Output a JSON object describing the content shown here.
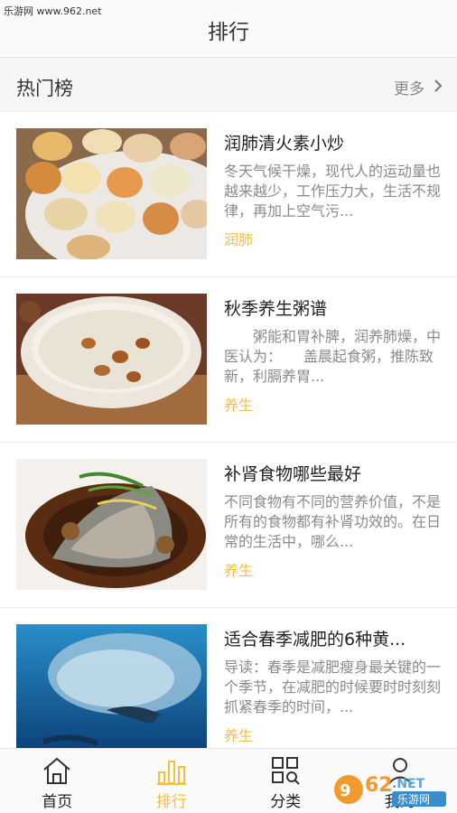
{
  "watermark": "乐游网 www.962.net",
  "header": {
    "title": "排行"
  },
  "section": {
    "title": "热门榜",
    "more_label": "更多"
  },
  "items": [
    {
      "title": "润肺清火素小炒",
      "desc": "冬天气候干燥，现代人的运动量也越来越少，工作压力大，生活不规律，再加上空气污...",
      "tag": "润肺"
    },
    {
      "title": "秋季养生粥谱",
      "desc": "　　粥能和胃补脾，润养肺燥，中医认为：　　盖晨起食粥，推陈致新，利膈养胃...",
      "tag": "养生"
    },
    {
      "title": "补肾食物哪些最好",
      "desc": "不同食物有不同的营养价值，不是所有的食物都有补肾功效的。在日常的生活中，哪么...",
      "tag": "养生"
    },
    {
      "title": "适合春季减肥的6种黄...",
      "desc": "导读：春季是减肥瘦身最关键的一个季节，在减肥的时候要时时刻刻抓紧春季的时间，...",
      "tag": "养生"
    }
  ],
  "tabbar": {
    "tabs": [
      {
        "label": "首页",
        "icon": "home-icon"
      },
      {
        "label": "排行",
        "icon": "bar-chart-icon"
      },
      {
        "label": "分类",
        "icon": "category-grid-icon"
      },
      {
        "label": "我的",
        "icon": "user-icon"
      }
    ],
    "active_index": 1
  },
  "logo": {
    "text": "962.NET",
    "subtext": "乐游网"
  },
  "colors": {
    "accent": "#f2c045",
    "text": "#222222",
    "muted": "#8a8a8a"
  }
}
